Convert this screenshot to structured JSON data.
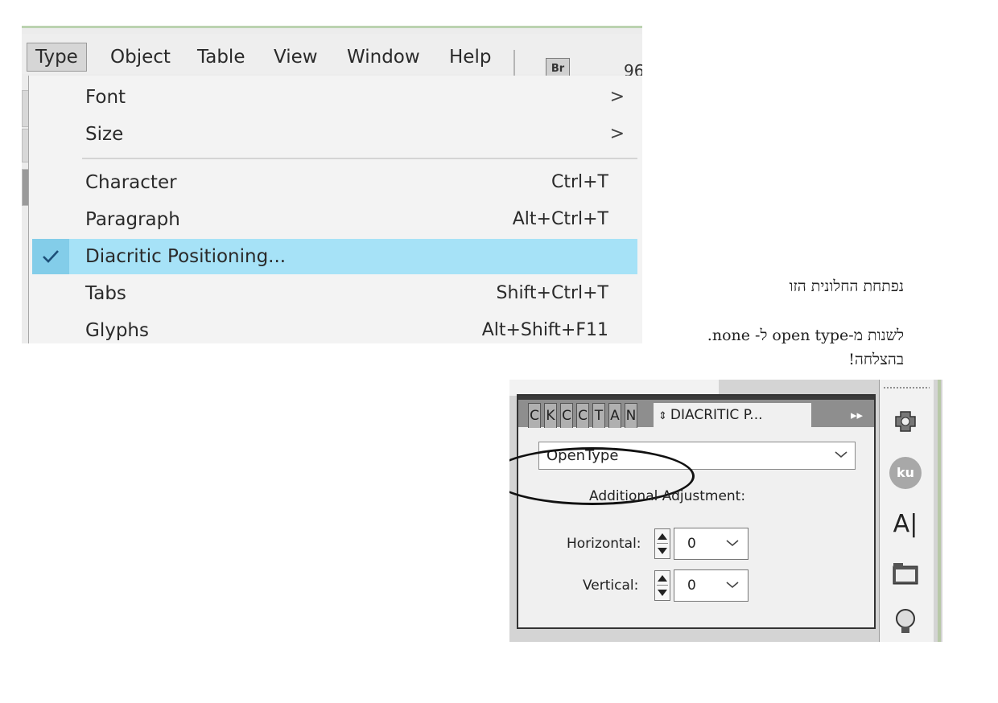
{
  "menubar": {
    "items": [
      {
        "label": "Type",
        "active": true
      },
      {
        "label": "Object"
      },
      {
        "label": "Table"
      },
      {
        "label": "View"
      },
      {
        "label": "Window"
      },
      {
        "label": "Help"
      }
    ],
    "bridge_icon": "Br",
    "zoom_partial": "96"
  },
  "type_menu": {
    "items": [
      {
        "label": "Font",
        "submenu": true
      },
      {
        "label": "Size",
        "submenu": true
      },
      {
        "label": "Character",
        "shortcut": "Ctrl+T"
      },
      {
        "label": "Paragraph",
        "shortcut": "Alt+Ctrl+T"
      },
      {
        "label": "Diacritic Positioning...",
        "checked": true,
        "highlighted": true
      },
      {
        "label": "Tabs",
        "shortcut": "Shift+Ctrl+T"
      },
      {
        "label": "Glyphs",
        "shortcut": "Alt+Shift+F11"
      }
    ],
    "submenu_glyph": ">",
    "highlight_color": "#a6e2f7"
  },
  "notes": {
    "line1": "נפתחת החלונית הזו",
    "line2": "לשנות מ-open type ל- none.",
    "line3": "בהצלחה!"
  },
  "panel": {
    "collapsed_tabs": [
      "C",
      "K",
      "C",
      "C",
      "T",
      "A",
      "N"
    ],
    "active_tab": "DIACRITIC P...",
    "active_tab_glyph": "⇕",
    "expand_glyph": "▸▸",
    "positioning_value": "OpenType",
    "adjustment_heading": "Additional Adjustment:",
    "horizontal_label": "Horizontal:",
    "horizontal_value": "0",
    "vertical_label": "Vertical:",
    "vertical_value": "0"
  },
  "dock": {
    "icons": [
      "plugin-icon",
      "kuler-icon",
      "character-style-icon",
      "folder-icon",
      "lightbulb-icon"
    ],
    "kuler_text": "ku",
    "character_text": "A|"
  }
}
